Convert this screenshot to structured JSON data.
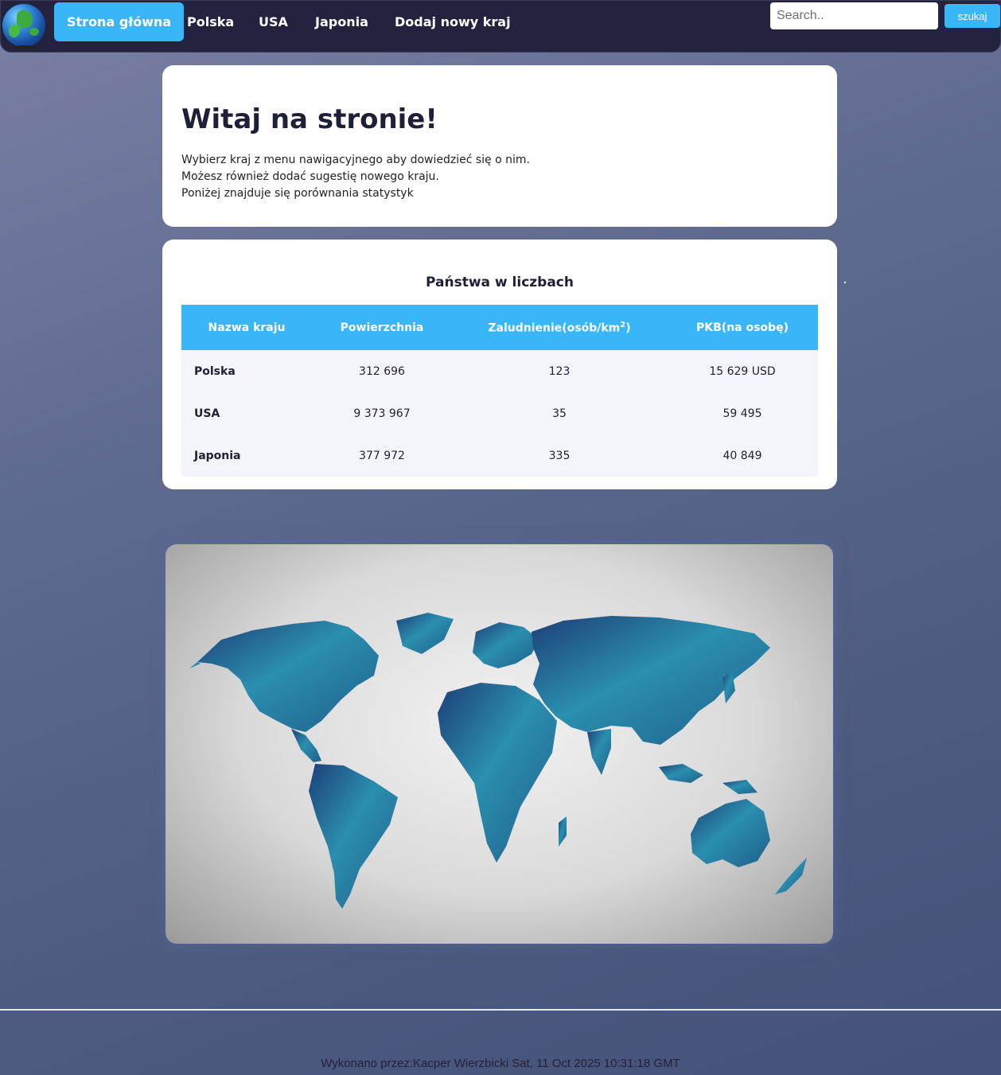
{
  "nav": {
    "items": [
      {
        "label": "Strona główna",
        "active": true
      },
      {
        "label": "Polska"
      },
      {
        "label": "USA"
      },
      {
        "label": "Japonia"
      },
      {
        "label": "Dodaj nowy kraj"
      }
    ],
    "search_placeholder": "Search..",
    "search_button": "szukaj"
  },
  "welcome": {
    "title": "Witaj na stronie!",
    "lines": [
      "Wybierz kraj z menu nawigacyjnego aby dowiedzieć się o nim.",
      "Możesz również dodać sugestię nowego kraju.",
      "Poniżej znajduje się porównania statystyk"
    ]
  },
  "stats": {
    "title": "Państwa w liczbach",
    "headers": [
      "Nazwa kraju",
      "Powierzchnia",
      "Zaludnienie(osób/km",
      "PKB(na osobę)"
    ],
    "header_sup": "2",
    "header_suffix": ")",
    "rows": [
      [
        "Polska",
        "312 696",
        "123",
        "15 629 USD"
      ],
      [
        "USA",
        "9 373 967",
        "35",
        "59 495"
      ],
      [
        "Japonia",
        "377 972",
        "335",
        "40 849"
      ]
    ]
  },
  "colors": {
    "accent": "#38b6f8",
    "navbar": "#23233f",
    "map_land": "#2b8fae"
  },
  "footer": {
    "text": "Wykonano przez:Kacper Wierzbicki Sat, 11 Oct 2025 10:31:18 GMT"
  }
}
